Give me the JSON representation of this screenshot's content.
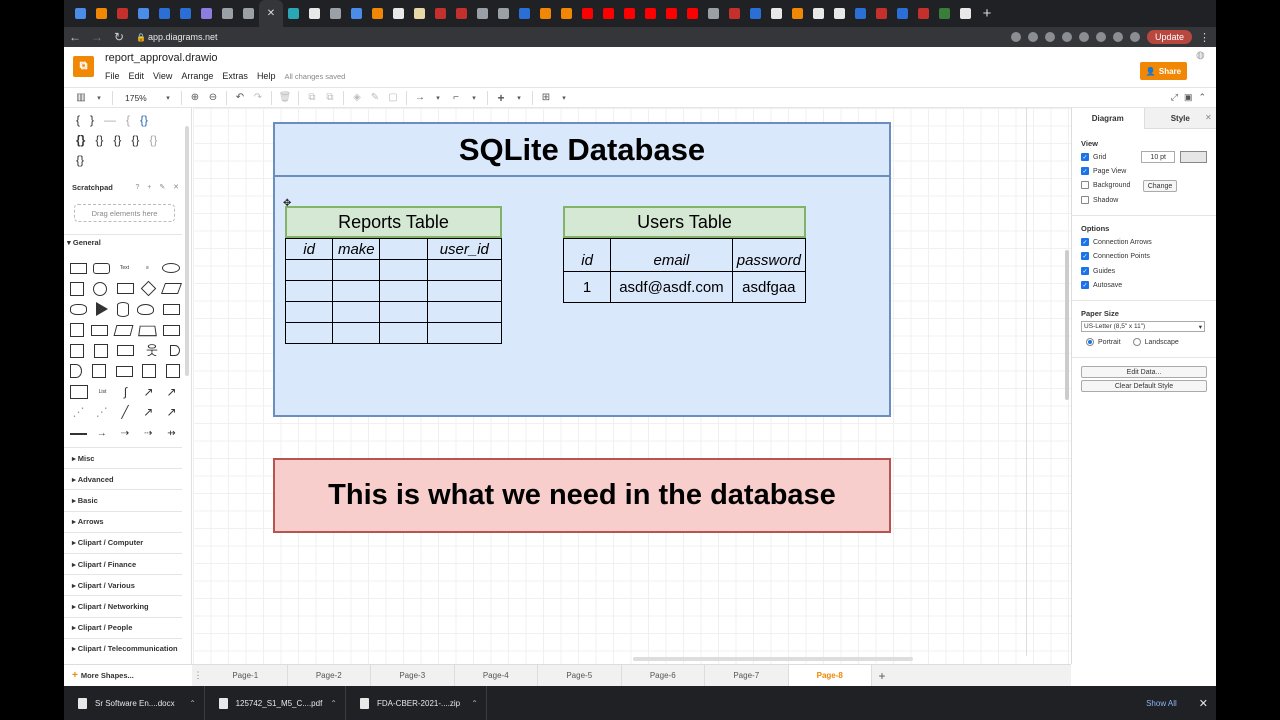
{
  "browser": {
    "tab_colors": [
      "#4a8ce8",
      "#f08705",
      "#c4302b",
      "#4a8ce8",
      "#2b6fd6",
      "#2b6fd6",
      "#8a7fe0",
      "#9aa0a6",
      "#9aa0a6",
      "#2aa6b5",
      "#e8e8e8",
      "#9aa0a6",
      "#4a8ce8",
      "#f08705",
      "#e8e8e8",
      "#e8d8a8",
      "#c4302b",
      "#c4302b",
      "#9aa0a6",
      "#9aa0a6",
      "#2b6fd6",
      "#f08705",
      "#f08705",
      "#ff0000",
      "#ff0000",
      "#ff0000",
      "#ff0000",
      "#ff0000",
      "#ff0000",
      "#9aa0a6",
      "#c4302b",
      "#2b6fd6",
      "#e8e8e8",
      "#f08705",
      "#e8e8e8",
      "#e8e8e8",
      "#2b6fd6",
      "#c4302b",
      "#2b6fd6",
      "#c4302b",
      "#3a7d3a",
      "#e8e8e8"
    ],
    "url": "app.diagrams.net",
    "update_label": "Update"
  },
  "app": {
    "filename": "report_approval.drawio",
    "menus": [
      "File",
      "Edit",
      "View",
      "Arrange",
      "Extras",
      "Help"
    ],
    "save_status": "All changes saved",
    "share_label": "Share",
    "zoom": "175%"
  },
  "sidebar": {
    "scratchpad_label": "Scratchpad",
    "scratchpad_icons": "? + ✎ ✕",
    "drag_hint": "Drag elements here",
    "general_label": "General",
    "categories": [
      "Misc",
      "Advanced",
      "Basic",
      "Arrows",
      "Clipart / Computer",
      "Clipart / Finance",
      "Clipart / Various",
      "Clipart / Networking",
      "Clipart / People",
      "Clipart / Telecommunication"
    ],
    "more_shapes": "More Shapes..."
  },
  "diagram": {
    "db_title": "SQLite Database",
    "reports": {
      "title": "Reports Table",
      "columns": [
        "id",
        "make",
        "",
        "user_id"
      ],
      "rows": [
        [
          "",
          "",
          "",
          ""
        ],
        [
          "",
          "",
          "",
          ""
        ],
        [
          "",
          "",
          "",
          ""
        ],
        [
          "",
          "",
          "",
          ""
        ]
      ]
    },
    "users": {
      "title": "Users Table",
      "columns": [
        "id",
        "email",
        "password"
      ],
      "rows": [
        [
          "1",
          "asdf@asdf.com",
          "asdfgaa"
        ]
      ]
    },
    "note": "This is what we need in the database"
  },
  "format_panel": {
    "tabs": [
      "Diagram",
      "Style"
    ],
    "view_label": "View",
    "grid_label": "Grid",
    "grid_size": "10 pt",
    "page_view_label": "Page View",
    "background_label": "Background",
    "change_label": "Change",
    "shadow_label": "Shadow",
    "options_label": "Options",
    "connection_arrows_label": "Connection Arrows",
    "connection_points_label": "Connection Points",
    "guides_label": "Guides",
    "autosave_label": "Autosave",
    "paper_size_label": "Paper Size",
    "paper_size": "US-Letter (8,5\" x 11\")",
    "portrait_label": "Portrait",
    "landscape_label": "Landscape",
    "edit_data_label": "Edit Data...",
    "clear_default_style_label": "Clear Default Style"
  },
  "pages": [
    "Page-1",
    "Page-2",
    "Page-3",
    "Page-4",
    "Page-5",
    "Page-6",
    "Page-7",
    "Page-8"
  ],
  "active_page": "Page-8",
  "downloads": {
    "items": [
      "Sr Software En....docx",
      "125742_S1_M5_C....pdf",
      "FDA-CBER-2021-....zip"
    ],
    "show_all": "Show All"
  }
}
